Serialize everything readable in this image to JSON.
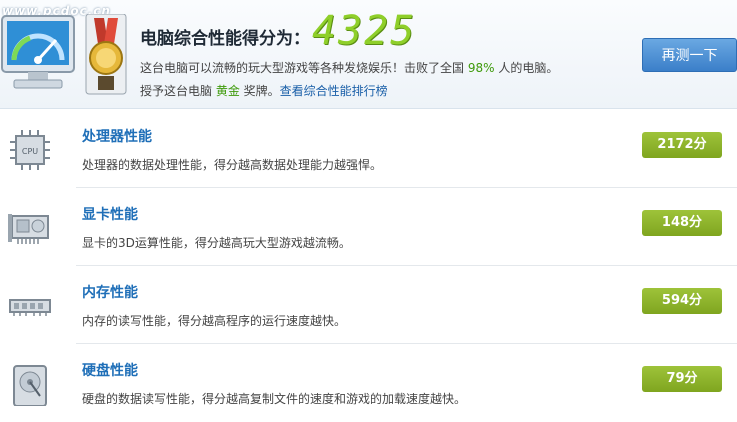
{
  "header": {
    "watermark": "www.pcdoc.cn",
    "score_title": "电脑综合性能得分为：",
    "score_value": "4325",
    "line2_pre": "这台电脑可以流畅的玩大型游戏等各种发烧娱乐！击败了全国 ",
    "beat_percent": "98%",
    "line2_post": " 人的电脑。",
    "award_pre": "授予这台电脑 ",
    "award_level": "黄金",
    "award_post": " 奖牌。",
    "ranking_link": "查看综合性能排行榜",
    "retest_button": "再测一下"
  },
  "categories": [
    {
      "name": "处理器性能",
      "desc": "处理器的数据处理性能，得分越高数据处理能力越强悍。",
      "score": "2172分",
      "icon": "cpu-icon"
    },
    {
      "name": "显卡性能",
      "desc": "显卡的3D运算性能，得分越高玩大型游戏越流畅。",
      "score": "148分",
      "icon": "graphics-card-icon"
    },
    {
      "name": "内存性能",
      "desc": "内存的读写性能，得分越高程序的运行速度越快。",
      "score": "594分",
      "icon": "memory-icon"
    },
    {
      "name": "硬盘性能",
      "desc": "硬盘的数据读写性能，得分越高复制文件的速度和游戏的加载速度越快。",
      "score": "79分",
      "icon": "hard-disk-icon"
    }
  ],
  "colors": {
    "score_green": "#8fcf2a",
    "badge_green": "#8bb02a",
    "link_blue": "#1a5fa8",
    "button_blue": "#3b7fc9"
  }
}
